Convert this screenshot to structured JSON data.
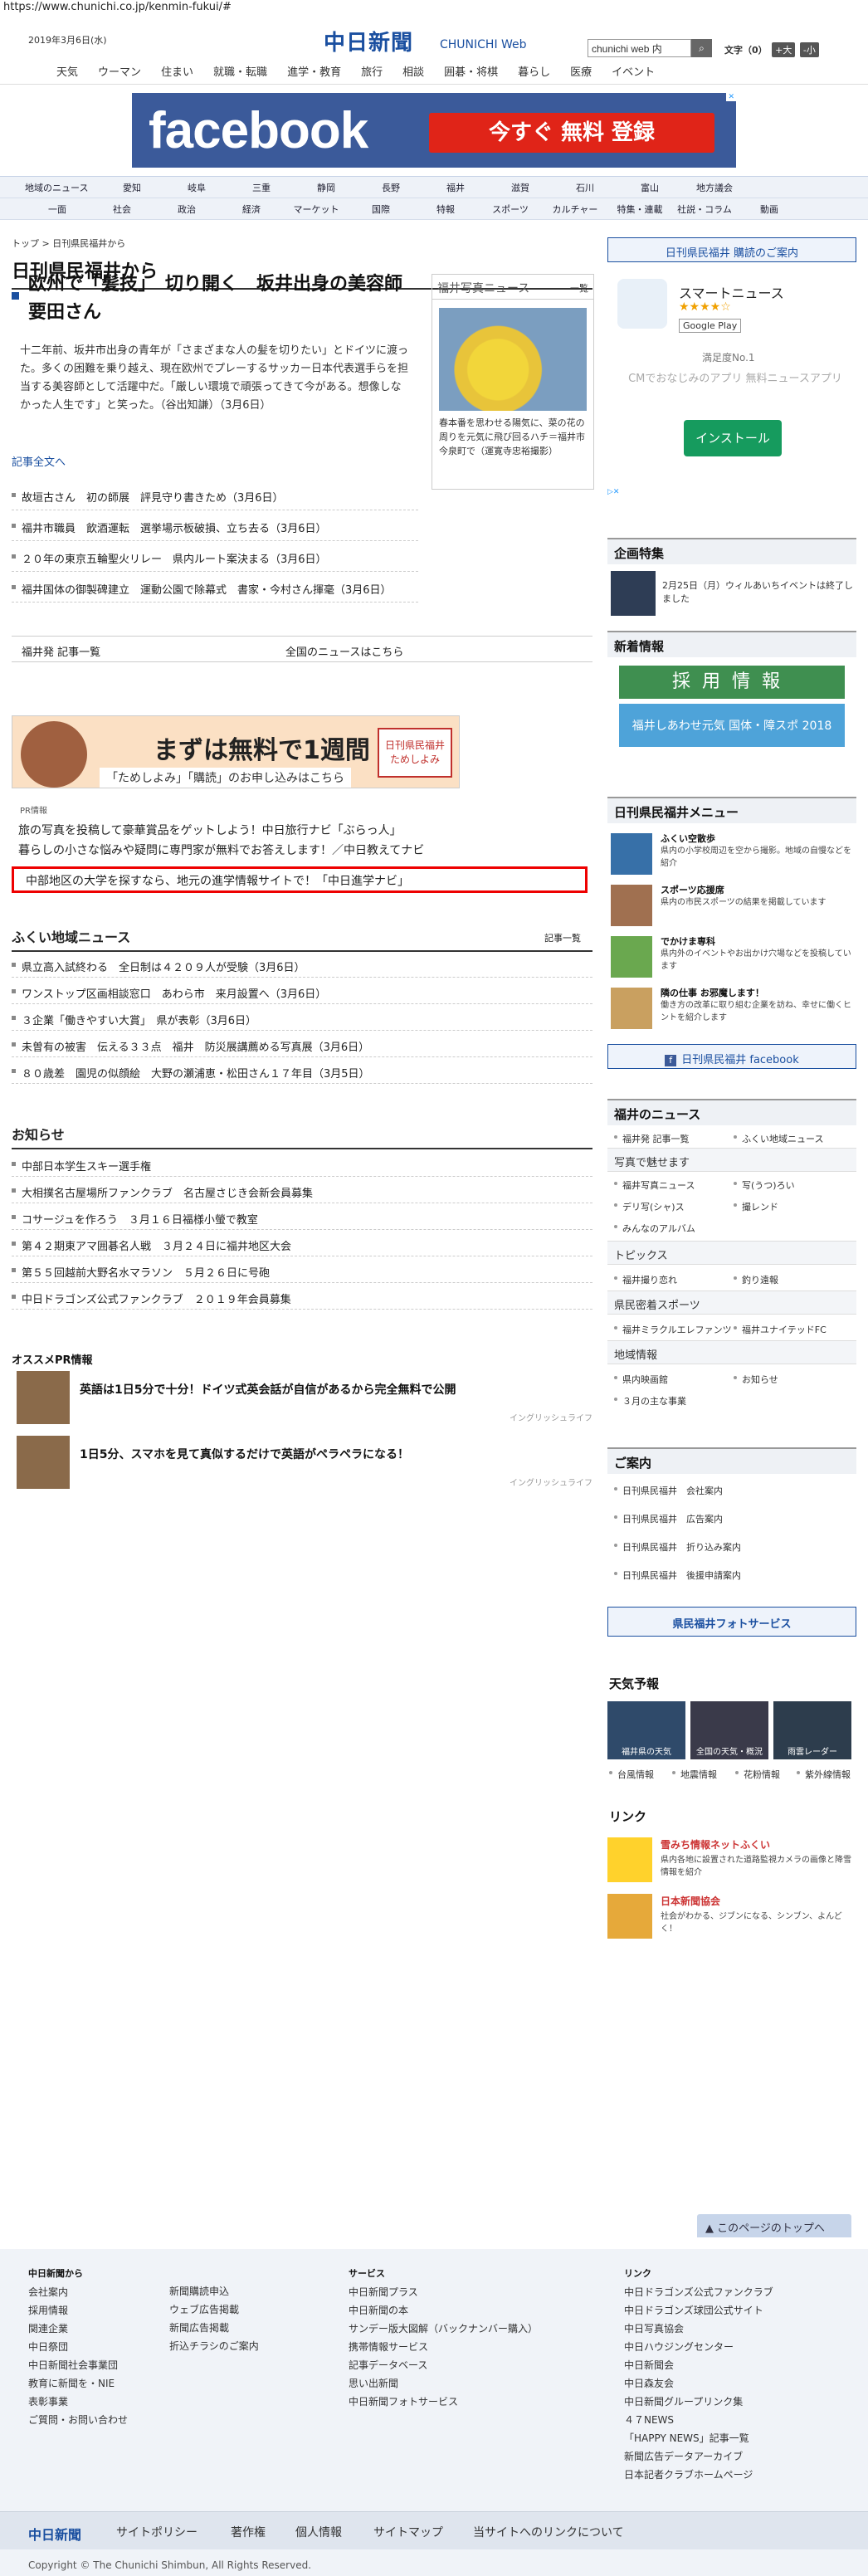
{
  "browser": {
    "url": "https://www.chunichi.co.jp/kenmin-fukui/#"
  },
  "header": {
    "date": "2019年3月6日(水)",
    "logo": "中日新聞",
    "logo_sub": "CHUNICHI Web",
    "search_value": "chunichi web 内",
    "font_label": "文字（0）",
    "font_plus": "+大",
    "font_minus": "-小"
  },
  "gnav": [
    "天気",
    "ウーマン",
    "住まい",
    "就職・転職",
    "進学・教育",
    "旅行",
    "相談",
    "囲碁・将棋",
    "暮らし",
    "医療",
    "イベント"
  ],
  "top_ad": {
    "brand": "facebook",
    "cta": "今すぐ 無料 登録"
  },
  "region_nav": {
    "row1": [
      "地域のニュース",
      "愛知",
      "岐阜",
      "三重",
      "静岡",
      "長野",
      "福井",
      "滋賀",
      "石川",
      "富山",
      "地方議会"
    ],
    "row2": [
      "一面",
      "社会",
      "政治",
      "経済",
      "マーケット",
      "国際",
      "特報",
      "スポーツ",
      "カルチャー",
      "特集・連載",
      "社説・コラム",
      "動画"
    ]
  },
  "breadcrumb": "トップ > 日刊県民福井から",
  "page_title": "日刊県民福井から",
  "lead": {
    "title": "欧州で「髪技」　切り開く　坂井出身の美容師　要田さん",
    "body": "十二年前、坂井市出身の青年が「さまざまな人の髪を切りたい」とドイツに渡った。多くの困難を乗り越え、現在欧州でプレーするサッカー日本代表選手らを担当する美容師として活躍中だ。「厳しい環境で頑張ってきて今がある。想像しなかった人生です」と笑った。（谷出知謙）（3月6日）",
    "more": "記事全文へ"
  },
  "photo_news": {
    "head": "福井写真ニュース",
    "list": "一覧",
    "caption": "春本番を思わせる陽気に、菜の花の周りを元気に飛び回るハチ＝福井市今泉町で（運寛寺忠裕撮影）"
  },
  "news": [
    "故垣古さん　初の師展　評見守り書きため（3月6日）",
    "福井市職員　飲酒運転　選挙場示板破損、立ち去る（3月6日）",
    "２０年の東京五輪聖火リレー　県内ルート案決まる（3月6日）",
    "福井国体の御製碑建立　運動公園で除幕式　書家・今村さん揮毫（3月6日）"
  ],
  "links": {
    "local": "福井発 記事一覧",
    "national": "全国のニュースはこちら"
  },
  "ad_small": {
    "text1": "まずは無料で1週間",
    "text2": "「ためしよみ」「購読」のお申し込みはこちら",
    "badge": "日刊県民福井 ためしよみ"
  },
  "pr": {
    "label": "PR情報",
    "items": [
      "旅の写真を投稿して豪華賞品をゲットしよう！中日旅行ナビ「ぶらっ人」",
      "暮らしの小さな悩みや疑問に専門家が無料でお答えします！／中日教えてナビ"
    ],
    "highlight": "中部地区の大学を探すなら、地元の進学情報サイトで！「中日進学ナビ」"
  },
  "local_news": {
    "head": "ふくい地域ニュース",
    "more": "記事一覧",
    "items": [
      "県立高入試終わる　全日制は４２０９人が受験（3月6日）",
      "ワンストップ区画相談窓口　あわら市　来月設置へ（3月6日）",
      "３企業「働きやすい大賞」　県が表彰（3月6日）",
      "未曽有の被害　伝える３３点　福井　防災展講薦める写真展（3月6日）",
      "８０歳差　園児の似顔絵　大野の瀬浦恵・松田さん１７年目（3月5日）"
    ]
  },
  "notice": {
    "head": "お知らせ",
    "items": [
      "中部日本学生スキー選手権",
      "大相撲名古屋場所ファンクラブ　名古屋さじき会新会員募集",
      "コサージュを作ろう　３月１６日福様小螢で教室",
      "第４２期東アマ囲碁名人戦　３月２４日に福井地区大会",
      "第５５回越前大野名水マラソン　５月２６日に号砲",
      "中日ドラゴンズ公式ファンクラブ　２０１９年会員募集"
    ]
  },
  "pr2": {
    "head": "オススメPR情報",
    "items": [
      {
        "title": "英語は1日5分で十分！ドイツ式英会話が自信があるから完全無料で公開",
        "src": "イングリッシュライフ"
      },
      {
        "title": "1日5分、スマホを見て真似するだけで英語がペラペラになる！",
        "src": "イングリッシュライフ"
      }
    ]
  },
  "sidebar": {
    "subscribe": "日刊県民福井 購読のご案内",
    "app_ad": {
      "name": "スマートニュース",
      "stars": "★★★★☆",
      "store": "Google Play",
      "sat": "満足度No.1",
      "desc": "CMでおなじみのアプリ 無料ニュースアプリ",
      "install": "インストール"
    },
    "feature_head": "企画特集",
    "feature_text": "2月25日（月）ウィルあいちイベントは終了しました",
    "job_head": "新着情報",
    "job_banner": "採用情報",
    "job_sub": "福井しあわせ元気 国体・障スポ 2018",
    "menu_head": "日刊県民福井メニュー",
    "menu": [
      {
        "t": "ふくい空散歩",
        "d": "県内の小学校周辺を空から撮影。地域の自慢などを紹介"
      },
      {
        "t": "スポーツ応援席",
        "d": "県内の市民スポーツの結果を掲載しています"
      },
      {
        "t": "でかけま専科",
        "d": "県内外のイベントやお出かけ穴場などを投稿しています"
      },
      {
        "t": "隣の仕事 お邪魔します！",
        "d": "働き方の改革に取り組む企業を訪ね、幸せに働くヒントを紹介します"
      }
    ],
    "facebook": "日刊県民福井 facebook",
    "news_head": "福井のニュース",
    "news_links": [
      "福井発 記事一覧",
      "ふくい地域ニュース"
    ],
    "photo_sub": "写真で魅せます",
    "photo_links": [
      "福井写真ニュース",
      "写(うつ)ろい",
      "デリ写(シャ)ス",
      "撮レンド",
      "みんなのアルバム"
    ],
    "topics_sub": "トピックス",
    "topics_links": [
      "福井撮り恋れ",
      "釣り遠報"
    ],
    "sports_sub": "県民密着スポーツ",
    "sports_links": [
      "福井ミラクルエレファンツ",
      "福井ユナイテッドFC"
    ],
    "area_sub": "地域情報",
    "area_links": [
      "県内映画館",
      "お知らせ",
      "３月の主な事業"
    ],
    "guide_head": "ご案内",
    "guide": [
      "日刊県民福井　会社案内",
      "日刊県民福井　広告案内",
      "日刊県民福井　折り込み案内",
      "日刊県民福井　後援申請案内"
    ],
    "photo_service": "県民福井フォトサービス",
    "weather_head": "天気予報",
    "weather": [
      "福井県の天気",
      "全国の天気・概況",
      "雨雲レーダー"
    ],
    "weather_links": [
      "台風情報",
      "地震情報",
      "花粉情報",
      "紫外線情報"
    ],
    "link_head": "リンク",
    "link1": {
      "t": "雪みち情報ネットふくい",
      "d": "県内各地に設置された道路監視カメラの画像と降雪情報を紹介"
    },
    "link2": {
      "t": "日本新聞協会",
      "d": "社会がわかる、ジブンになる、シンブン、よんどく！"
    }
  },
  "footer": {
    "totop": "このページのトップへ",
    "col1_head": "中日新聞から",
    "col1": [
      "会社案内",
      "採用情報",
      "関連企業",
      "中日祭団",
      "中日新聞社会事業団",
      "教育に新聞を・NIE",
      "表彰事業",
      "ご質問・お問い合わせ"
    ],
    "col2": [
      "新聞購読申込",
      "ウェブ広告掲載",
      "新聞広告掲載",
      "折込チラシのご案内"
    ],
    "col3_head": "サービス",
    "col3": [
      "中日新聞プラス",
      "中日新聞の本",
      "サンデー版大図解（バックナンバー購入）",
      "携帯情報サービス",
      "記事データベース",
      "思い出新聞",
      "中日新聞フォトサービス"
    ],
    "col4_head": "リンク",
    "col4": [
      "中日ドラゴンズ公式ファンクラブ",
      "中日ドラゴンズ球団公式サイト",
      "中日写真協会",
      "中日ハウジングセンター",
      "中日新聞会",
      "中日森友会",
      "中日新聞グループリンク集",
      "４７NEWS",
      "「HAPPY NEWS」記事一覧",
      "新聞広告データアーカイブ",
      "日本記者クラブホームページ"
    ],
    "nav": [
      "中日新聞",
      "サイトポリシー",
      "著作権",
      "個人情報",
      "サイトマップ",
      "当サイトへのリンクについて"
    ],
    "copyright": "Copyright © The Chunichi Shimbun, All Rights Reserved."
  }
}
